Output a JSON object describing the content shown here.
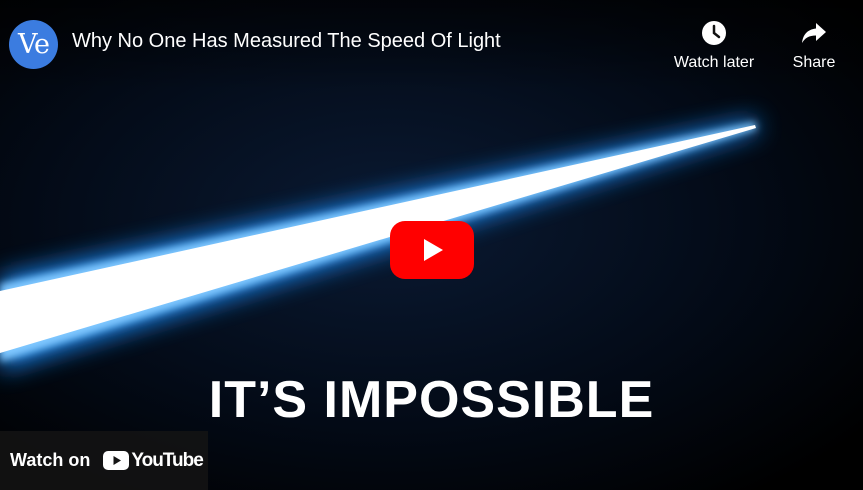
{
  "video": {
    "channel_avatar_text": "Ve",
    "title": "Why No One Has Measured The Speed Of Light",
    "caption": "IT’S IMPOSSIBLE"
  },
  "actions": {
    "watch_later_label": "Watch later",
    "share_label": "Share"
  },
  "footer": {
    "watch_on_label": "Watch on",
    "youtube_wordmark": "YouTube"
  },
  "icons": {
    "watch_later": "clock-icon",
    "share": "share-arrow-icon",
    "play": "play-button-icon",
    "youtube": "youtube-logo-icon"
  },
  "colors": {
    "play_button": "#ff0000",
    "avatar": "#3b7ce0",
    "beam_glow": "#1e90ff"
  }
}
